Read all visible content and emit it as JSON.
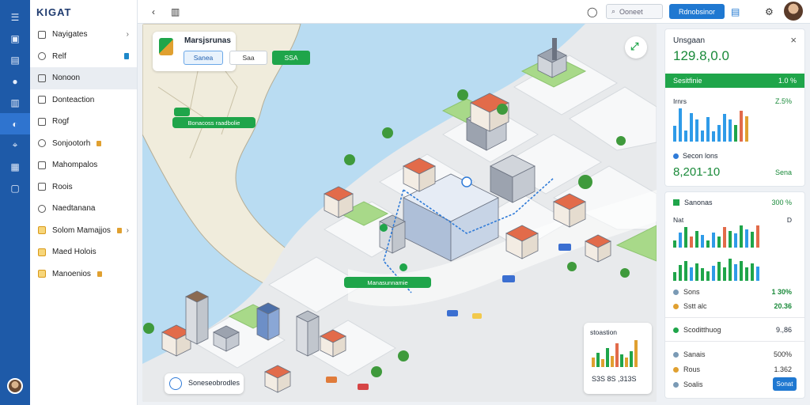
{
  "app": {
    "brand": "KIGAT"
  },
  "rail_icons": [
    "menu-icon",
    "inbox-icon",
    "grid-icon",
    "user-icon",
    "chart-icon",
    "map-icon",
    "location-icon",
    "table-icon",
    "square-icon"
  ],
  "sidebar": {
    "items": [
      {
        "label": "Nayigates",
        "chev": "›"
      },
      {
        "label": "Relf"
      },
      {
        "label": "Nonoon"
      },
      {
        "label": "Donteaction"
      },
      {
        "label": "Rogf"
      },
      {
        "label": "Sonjootorh"
      },
      {
        "label": "Mahompalos"
      },
      {
        "label": "Roois"
      },
      {
        "label": "Naedtanana"
      },
      {
        "label": "Solom Mamajjos",
        "chev": "›"
      },
      {
        "label": "Maed Holois"
      },
      {
        "label": "Manoenios"
      }
    ]
  },
  "topbar": {
    "search": "Ooneet",
    "button": "Rdnobsinor"
  },
  "map": {
    "title": "Marsjsrunas",
    "btn1": "Sanea",
    "btn2": "Saa",
    "btn3": "SSA",
    "route_label": "Bonacoss raadbolie",
    "route_label2": "Manasunnamie",
    "bottom_label": "Soneseobrodles",
    "mini_title": "stoastion",
    "mini_value": "S3S 8S ,313S"
  },
  "panel": {
    "header": "Unsgaan",
    "big": "129.8,0.0",
    "close": "×",
    "bar_label": "Sesitfinie",
    "bar_value": "1.0 %",
    "sub1": "Irnrs",
    "sub1_val": "Z.5%",
    "chart1": [
      28,
      60,
      20,
      52,
      40,
      20,
      44,
      18,
      30,
      50,
      40,
      30,
      55,
      45
    ],
    "sec_label": "Secon lons",
    "sec_value": "8,201-10",
    "sec_badge": "Sena",
    "card2_title": "Sanonas",
    "card2_val": "300 %",
    "card2_sub": "Nat",
    "card2_sub_val": "D",
    "chart2": [
      20,
      40,
      55,
      30,
      45,
      35,
      20,
      40,
      30,
      55,
      45,
      38,
      60,
      50,
      42,
      60
    ],
    "chart3": [
      20,
      35,
      45,
      30,
      40,
      28,
      22,
      34,
      42,
      30,
      50,
      38,
      44,
      30,
      40,
      32
    ],
    "rows": [
      {
        "label": "Sons",
        "val": "1 30%",
        "color": "#7a9ab5"
      },
      {
        "label": "Sstt alc",
        "val": "20.36",
        "color": "#e0a030"
      }
    ],
    "stat_title": "Scoditthuog",
    "stat_val": "9.,86",
    "list": [
      {
        "label": "Sanais",
        "val": "500%",
        "color": "#7a9ab5"
      },
      {
        "label": "Rous",
        "val": "1.362",
        "color": "#e0a030"
      },
      {
        "label": "Soalis",
        "val": "",
        "color": "#7a9ab5"
      }
    ],
    "apply": "Sonat"
  }
}
